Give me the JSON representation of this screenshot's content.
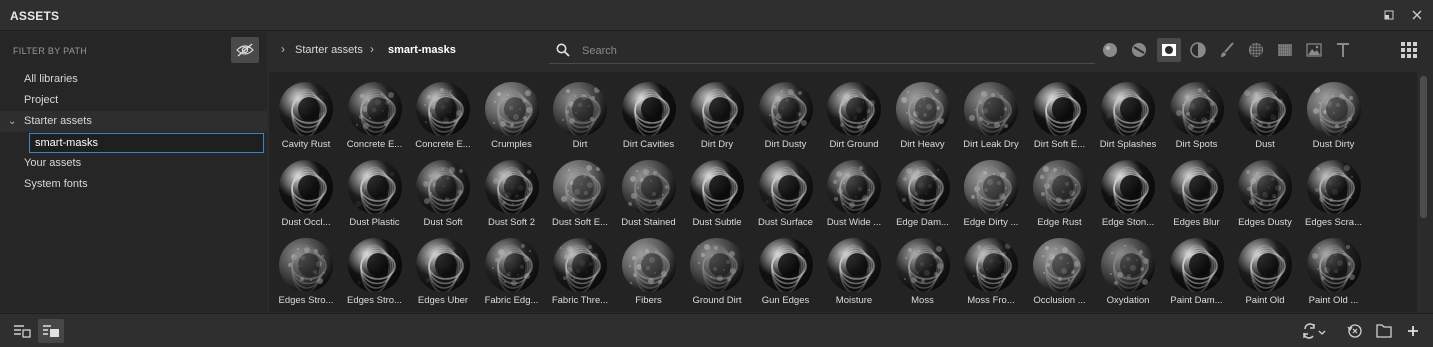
{
  "window": {
    "title": "ASSETS"
  },
  "left_panel": {
    "filter_label": "FILTER BY PATH",
    "tree": [
      {
        "label": "All libraries"
      },
      {
        "label": "Project"
      },
      {
        "label": "Starter assets",
        "expanded": true
      },
      {
        "label": "smart-masks",
        "selected": true
      },
      {
        "label": "Your assets"
      },
      {
        "label": "System fonts"
      }
    ]
  },
  "toolbar": {
    "breadcrumb": [
      "Starter assets",
      "smart-masks"
    ],
    "search_placeholder": "Search",
    "filters": [
      "materials-filter-icon",
      "smart-materials-filter-icon",
      "smart-masks-filter-icon",
      "filters-filter-icon",
      "brushes-filter-icon",
      "alphas-filter-icon",
      "grunges-filter-icon",
      "environments-filter-icon",
      "fonts-filter-icon"
    ],
    "active_filter": "smart-masks-filter-icon"
  },
  "assets": [
    "Cavity Rust",
    "Concrete E...",
    "Concrete E...",
    "Crumples",
    "Dirt",
    "Dirt Cavities",
    "Dirt Dry",
    "Dirt Dusty",
    "Dirt Ground",
    "Dirt Heavy",
    "Dirt Leak Dry",
    "Dirt Soft E...",
    "Dirt Splashes",
    "Dirt Spots",
    "Dust",
    "Dust Dirty",
    "Dust Occl...",
    "Dust Plastic",
    "Dust Soft",
    "Dust Soft 2",
    "Dust Soft E...",
    "Dust Stained",
    "Dust Subtle",
    "Dust Surface",
    "Dust Wide ...",
    "Edge Dam...",
    "Edge Dirty ...",
    "Edge Rust",
    "Edge Ston...",
    "Edges Blur",
    "Edges Dusty",
    "Edges Scra...",
    "Edges Stro...",
    "Edges Stro...",
    "Edges Uber",
    "Fabric Edg...",
    "Fabric Thre...",
    "Fibers",
    "Ground Dirt",
    "Gun Edges",
    "Moisture",
    "Moss",
    "Moss Fro...",
    "Occlusion ...",
    "Oxydation",
    "Paint Dam...",
    "Paint Old",
    "Paint Old ..."
  ],
  "colors": {
    "accent": "#3d82c9",
    "panel": "#262626",
    "grid_bg": "#232323"
  }
}
